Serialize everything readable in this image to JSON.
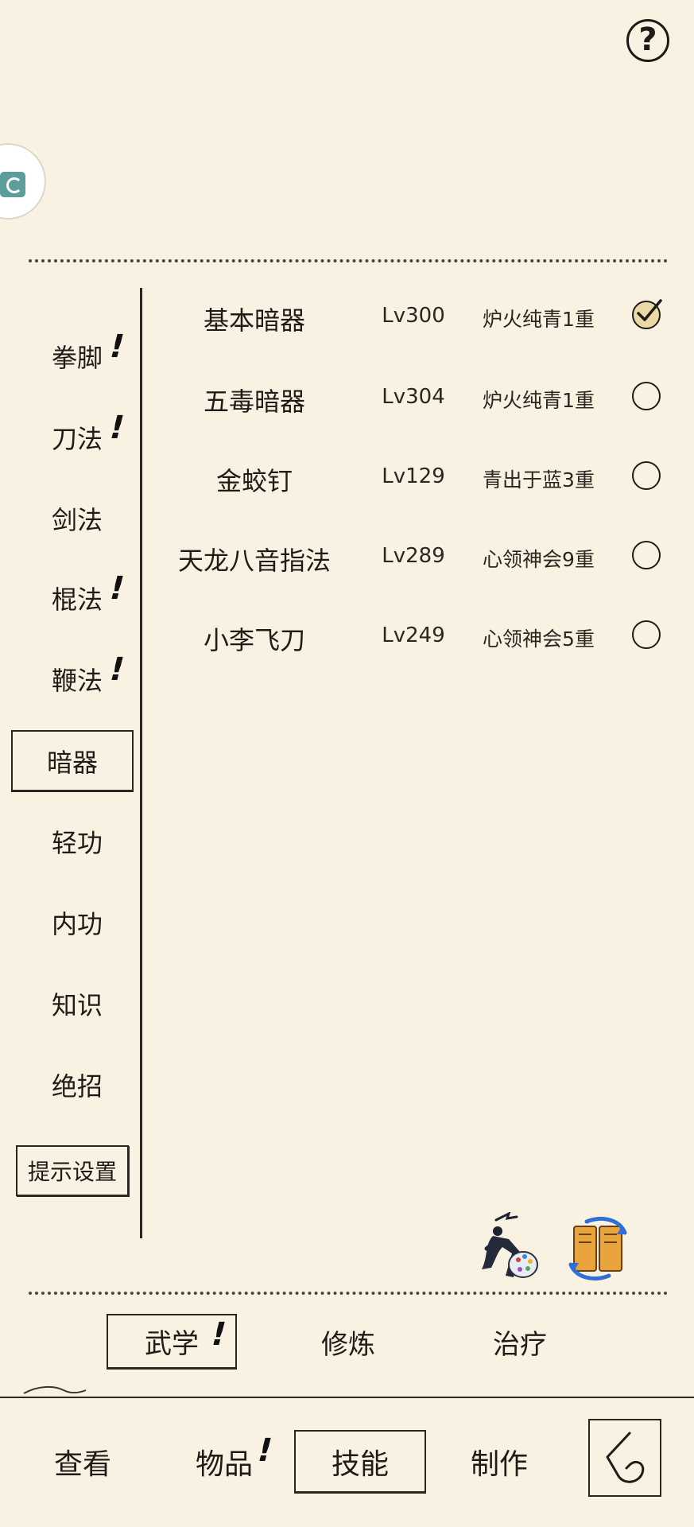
{
  "header": {
    "help_label": "?"
  },
  "categories": [
    {
      "label": "拳脚",
      "alert": "!"
    },
    {
      "label": "刀法",
      "alert": "!"
    },
    {
      "label": "剑法",
      "alert": ""
    },
    {
      "label": "棍法",
      "alert": "!"
    },
    {
      "label": "鞭法",
      "alert": "!"
    },
    {
      "label": "暗器",
      "alert": "",
      "selected": true
    },
    {
      "label": "轻功",
      "alert": ""
    },
    {
      "label": "内功",
      "alert": ""
    },
    {
      "label": "知识",
      "alert": ""
    },
    {
      "label": "绝招",
      "alert": ""
    }
  ],
  "tip_settings_label": "提示设置",
  "skills": [
    {
      "name": "基本暗器",
      "level": "Lv300",
      "stage": "炉火纯青1重",
      "equipped": true
    },
    {
      "name": "五毒暗器",
      "level": "Lv304",
      "stage": "炉火纯青1重",
      "equipped": false
    },
    {
      "name": "金蛟钉",
      "level": "Lv129",
      "stage": "青出于蓝3重",
      "equipped": false
    },
    {
      "name": "天龙八音指法",
      "level": "Lv289",
      "stage": "心领神会9重",
      "equipped": false
    },
    {
      "name": "小李飞刀",
      "level": "Lv249",
      "stage": "心领神会5重",
      "equipped": false
    }
  ],
  "sub_tabs": [
    {
      "label": "武学",
      "alert": "!",
      "selected": true
    },
    {
      "label": "修炼",
      "alert": ""
    },
    {
      "label": "治疗",
      "alert": ""
    }
  ],
  "bottom_nav": [
    {
      "label": "查看",
      "alert": ""
    },
    {
      "label": "物品",
      "alert": "!"
    },
    {
      "label": "技能",
      "alert": "",
      "selected": true
    },
    {
      "label": "制作",
      "alert": ""
    }
  ],
  "icons": {
    "help": "question-icon",
    "avatar": "app-badge-icon",
    "martial_art": "swordsman-palette-icon",
    "swap": "scroll-swap-icon",
    "back": "back-arrow-icon"
  },
  "colors": {
    "background": "#f9f1e2",
    "ink": "#1f1c18",
    "checked_fill": "#ecd9a6",
    "badge": "#5c9e9a"
  }
}
